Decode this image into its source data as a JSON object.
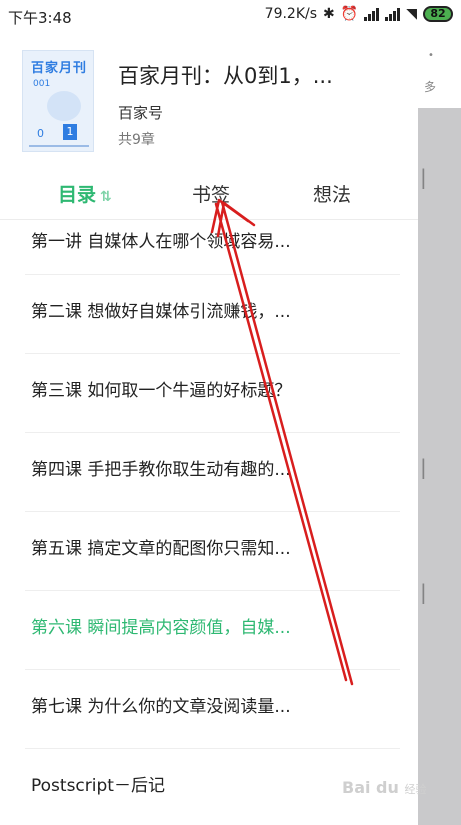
{
  "status_bar": {
    "time": "下午3:48",
    "network_speed": "79.2K/s",
    "battery": "82"
  },
  "book": {
    "title": "百家月刊：从0到1，...",
    "author": "百家号",
    "chapter_count": "共9章",
    "cover": {
      "title": "百家月刊",
      "issue": "001",
      "num_zero": "0",
      "num_one": "1"
    }
  },
  "tabs": [
    {
      "label": "目录",
      "icon": "sort-icon",
      "active": true
    },
    {
      "label": "书签",
      "active": false
    },
    {
      "label": "想法",
      "active": false
    }
  ],
  "chapters": [
    {
      "label": "第一讲 自媒体人在哪个领域容易..."
    },
    {
      "label": "第二课 想做好自媒体引流赚钱，..."
    },
    {
      "label": "第三课 如何取一个牛逼的好标题？"
    },
    {
      "label": "第四课 手把手教你取生动有趣的..."
    },
    {
      "label": "第五课 搞定文章的配图你只需知..."
    },
    {
      "label": "第六课 瞬间提高内容颜值，自媒...",
      "current": true
    },
    {
      "label": "第七课 为什么你的文章没阅读量..."
    },
    {
      "label": "Postscript－后记"
    }
  ],
  "background_page": {
    "more_label": "多",
    "dots": "•"
  },
  "watermark": {
    "brand": "Bai du",
    "sub": "经验"
  },
  "colors": {
    "accent_green": "#2eb872",
    "arrow_red": "#d81e1e",
    "cover_blue": "#2f7de1"
  }
}
